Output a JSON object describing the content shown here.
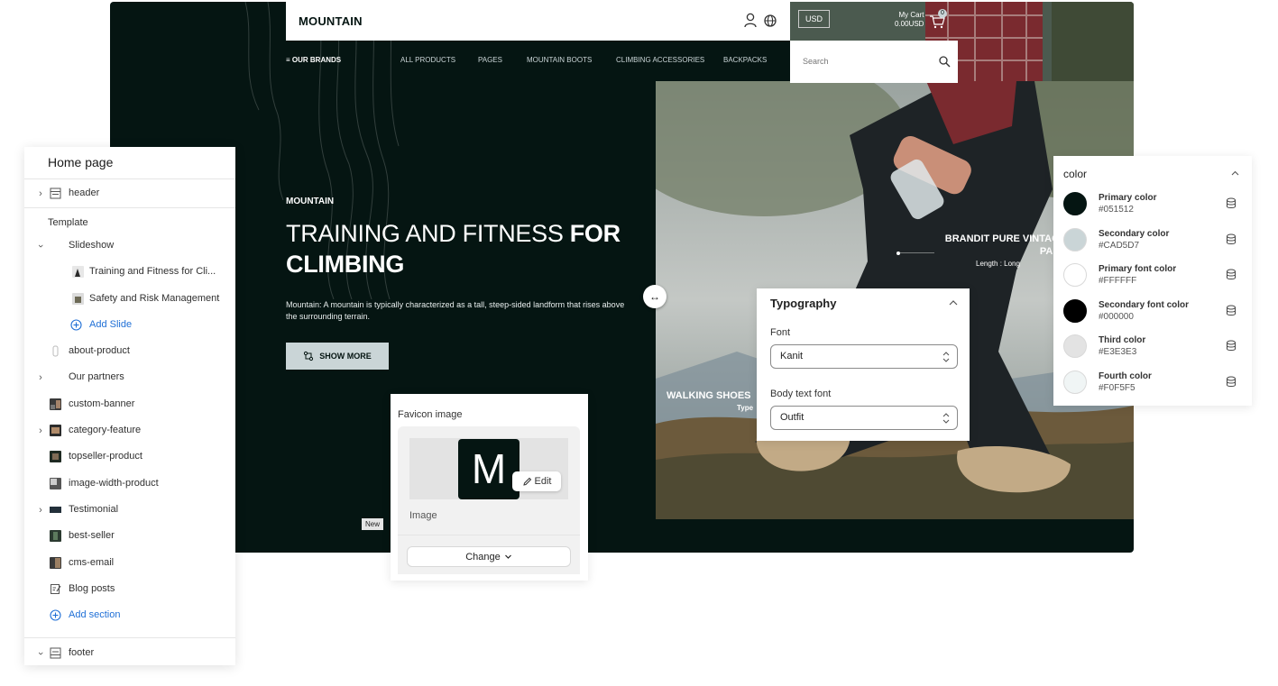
{
  "store": {
    "logo": "MOUNTAIN",
    "currency": "USD",
    "cart_label": "My Cart",
    "cart_amount": "0.00USD",
    "cart_count": "0",
    "search_placeholder": "Search",
    "nav": {
      "brands": "OUR BRANDS",
      "items": [
        "ALL PRODUCTS",
        "PAGES",
        "MOUNTAIN BOOTS",
        "CLIMBING ACCESSORIES",
        "BACKPACKS"
      ]
    },
    "hero": {
      "eyebrow": "MOUNTAIN",
      "title_light": "TRAINING AND FITNESS ",
      "title_bold_1": "FOR",
      "title_bold_2": "CLIMBING",
      "description": "Mountain: A mountain is typically characterized as a tall, steep-sided landform that rises above the surrounding terrain.",
      "cta": "SHOW MORE"
    },
    "product_1_line1": "BRANDIT PURE VINTAGE",
    "product_1_line2": "PANT",
    "product_1_meta": "Length : Long",
    "product_2": "WALKING SHOES",
    "product_2_meta": "Type",
    "new_badge": "New"
  },
  "sidebar": {
    "title": "Home page",
    "header": "header",
    "template_label": "Template",
    "slideshow": "Slideshow",
    "slides": [
      "Training and Fitness for Cli...",
      "Safety and Risk Management"
    ],
    "add_slide": "Add Slide",
    "sections": [
      "about-product",
      "Our partners",
      "custom-banner",
      "category-feature",
      "topseller-product",
      "image-width-product",
      "Testimonial",
      "best-seller",
      "cms-email",
      "Blog posts"
    ],
    "add_section": "Add section",
    "footer": "footer"
  },
  "favicon": {
    "title": "Favicon image",
    "letter": "M",
    "edit": "Edit",
    "image_label": "Image",
    "change": "Change"
  },
  "typography": {
    "title": "Typography",
    "font_label": "Font",
    "font_value": "Kanit",
    "body_label": "Body text font",
    "body_value": "Outfit"
  },
  "color": {
    "title": "color",
    "items": [
      {
        "name": "Primary color",
        "value": "#051512"
      },
      {
        "name": "Secondary color",
        "value": "#CAD5D7"
      },
      {
        "name": "Primary font color",
        "value": "#FFFFFF"
      },
      {
        "name": "Secondary font color",
        "value": "#000000"
      },
      {
        "name": "Third color",
        "value": "#E3E3E3"
      },
      {
        "name": "Fourth color",
        "value": "#F0F5F5"
      }
    ]
  }
}
